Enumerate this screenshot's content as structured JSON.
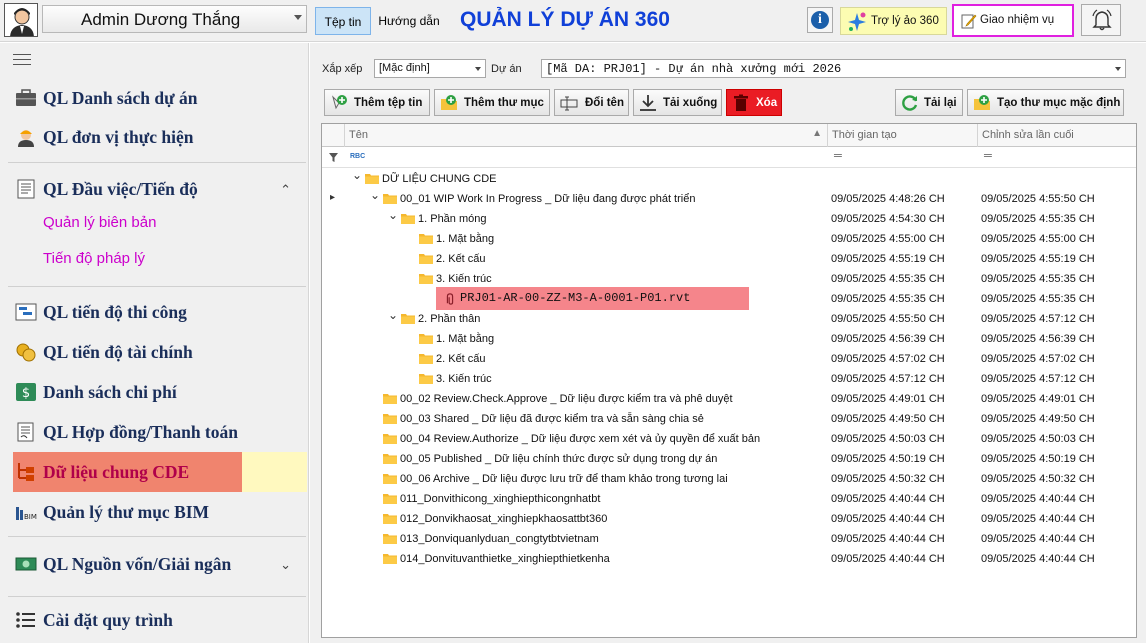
{
  "user": {
    "name": "Admin Dương Thắng"
  },
  "menu": {
    "file": "Tệp tin",
    "help": "Hướng dẫn"
  },
  "app_title": "QUẢN LÝ DỰ ÁN 360",
  "header_buttons": {
    "assistant": "Trợ lý ảo 360",
    "task": "Giao nhiệm vụ"
  },
  "sidebar": {
    "items": [
      {
        "label": "QL Danh sách dự án",
        "icon": "briefcase-icon"
      },
      {
        "label": "QL đơn vị thực hiện",
        "icon": "worker-icon"
      },
      {
        "label": "QL Đầu việc/Tiến độ",
        "icon": "document-list-icon"
      },
      {
        "label": "QL tiến độ thi công",
        "icon": "gantt-icon"
      },
      {
        "label": "QL tiến độ tài chính",
        "icon": "coins-icon"
      },
      {
        "label": "Danh sách chi phí",
        "icon": "money-icon"
      },
      {
        "label": "QL Hợp đồng/Thanh toán",
        "icon": "contract-icon"
      },
      {
        "label": "Dữ liệu chung CDE",
        "icon": "tree-icon"
      },
      {
        "label": "Quản lý thư mục BIM",
        "icon": "bim-icon"
      },
      {
        "label": "QL Nguồn vốn/Giải ngân",
        "icon": "cash-icon"
      },
      {
        "label": "Cài đặt quy trình",
        "icon": "list-icon"
      }
    ],
    "subitems": [
      "Quản lý biên bản",
      "Tiến độ pháp lý"
    ]
  },
  "filters": {
    "sort_label": "Xắp xếp",
    "sort_value": "[Mặc định]",
    "project_label": "Dự án",
    "project_value": "[Mã DA: PRJ01] - Dự án nhà xưởng mới 2026"
  },
  "toolbar": {
    "new_file": "Thêm tệp tin",
    "new_folder": "Thêm thư mục",
    "rename": "Đổi tên",
    "download": "Tải xuống",
    "delete": "Xóa",
    "reload": "Tải lại",
    "default_folders": "Tạo thư mục mặc định"
  },
  "grid": {
    "columns": [
      "Tên",
      "Thời gian tạo",
      "Chỉnh sửa lần cuối"
    ],
    "filter_glyph": "RBC",
    "rows": [
      {
        "name": "DỮ LIỆU CHUNG CDE",
        "created": "",
        "edited": ""
      },
      {
        "name": "00_01 WIP Work In Progress _ Dữ liệu đang được phát triển",
        "created": "09/05/2025 4:48:26 CH",
        "edited": "09/05/2025 4:55:50 CH"
      },
      {
        "name": "1. Phần móng",
        "created": "09/05/2025 4:54:30 CH",
        "edited": "09/05/2025 4:55:35 CH"
      },
      {
        "name": "1. Mặt bằng",
        "created": "09/05/2025 4:55:00 CH",
        "edited": "09/05/2025 4:55:00 CH"
      },
      {
        "name": "2. Kết cấu",
        "created": "09/05/2025 4:55:19 CH",
        "edited": "09/05/2025 4:55:19 CH"
      },
      {
        "name": "3. Kiến trúc",
        "created": "09/05/2025 4:55:35 CH",
        "edited": "09/05/2025 4:55:35 CH"
      },
      {
        "name": "PRJ01-AR-00-ZZ-M3-A-0001-P01.rvt",
        "created": "09/05/2025 4:55:35 CH",
        "edited": "09/05/2025 4:55:35 CH"
      },
      {
        "name": "2. Phần thân",
        "created": "09/05/2025 4:55:50 CH",
        "edited": "09/05/2025 4:57:12 CH"
      },
      {
        "name": "1. Mặt bằng",
        "created": "09/05/2025 4:56:39 CH",
        "edited": "09/05/2025 4:56:39 CH"
      },
      {
        "name": "2. Kết cấu",
        "created": "09/05/2025 4:57:02 CH",
        "edited": "09/05/2025 4:57:02 CH"
      },
      {
        "name": "3. Kiến trúc",
        "created": "09/05/2025 4:57:12 CH",
        "edited": "09/05/2025 4:57:12 CH"
      },
      {
        "name": "00_02 Review.Check.Approve _ Dữ liệu được kiểm tra và phê duyệt",
        "created": "09/05/2025 4:49:01 CH",
        "edited": "09/05/2025 4:49:01 CH"
      },
      {
        "name": "00_03 Shared _ Dữ liệu đã được kiểm tra và sẵn sàng chia sẻ",
        "created": "09/05/2025 4:49:50 CH",
        "edited": "09/05/2025 4:49:50 CH"
      },
      {
        "name": "00_04 Review.Authorize _ Dữ liệu được xem xét và ủy quyền để xuất bản",
        "created": "09/05/2025 4:50:03 CH",
        "edited": "09/05/2025 4:50:03 CH"
      },
      {
        "name": "00_05 Published _ Dữ liệu chính thức được sử dụng trong dự án",
        "created": "09/05/2025 4:50:19 CH",
        "edited": "09/05/2025 4:50:19 CH"
      },
      {
        "name": "00_06 Archive _ Dữ liệu được lưu trữ để tham khảo trong tương lai",
        "created": "09/05/2025 4:50:32 CH",
        "edited": "09/05/2025 4:50:32 CH"
      },
      {
        "name": "011_Donvithicong_xinghiepthicongnhatbt",
        "created": "09/05/2025 4:40:44 CH",
        "edited": "09/05/2025 4:40:44 CH"
      },
      {
        "name": "012_Donvikhaosat_xinghiepkhaosattbt360",
        "created": "09/05/2025 4:40:44 CH",
        "edited": "09/05/2025 4:40:44 CH"
      },
      {
        "name": "013_Donviquanlyduan_congtytbtvietnam",
        "created": "09/05/2025 4:40:44 CH",
        "edited": "09/05/2025 4:40:44 CH"
      },
      {
        "name": "014_Donvituvanthietke_xinghiepthietkenha",
        "created": "09/05/2025 4:40:44 CH",
        "edited": "09/05/2025 4:40:44 CH"
      }
    ]
  }
}
